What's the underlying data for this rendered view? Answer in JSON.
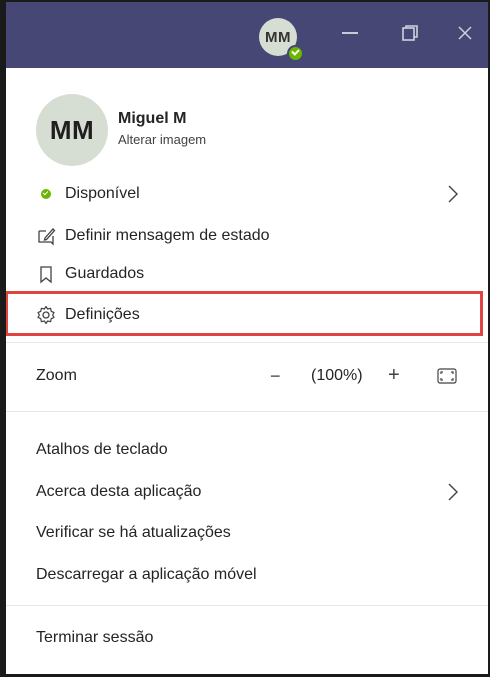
{
  "titlebar": {
    "avatar_initials": "MM",
    "status": "available",
    "colors": {
      "bar": "#464775",
      "status": "#6bb700"
    },
    "icons": [
      "minimize-icon",
      "maximize-icon",
      "close-icon"
    ]
  },
  "profile": {
    "initials": "MM",
    "name": "Miguel M",
    "change_image": "Alterar imagem"
  },
  "menu": {
    "status_label": "Disponível",
    "set_status_message": "Definir mensagem de estado",
    "saved": "Guardados",
    "settings": "Definições"
  },
  "zoom": {
    "label": "Zoom",
    "minus": "−",
    "value": "(100%)",
    "plus": "+"
  },
  "secondary": {
    "shortcuts": "Atalhos de teclado",
    "about": "Acerca desta aplicação",
    "check_updates": "Verificar se há atualizações",
    "download_mobile": "Descarregar a aplicação móvel"
  },
  "footer": {
    "sign_out": "Terminar sessão"
  },
  "highlight_color": "#e0443e"
}
